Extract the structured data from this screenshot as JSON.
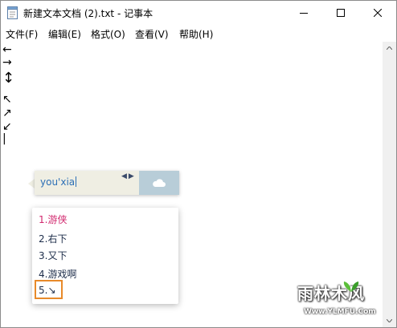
{
  "window": {
    "title": "新建文本文档 (2).txt - 记事本"
  },
  "menu": [
    {
      "label": "文件(F)"
    },
    {
      "label": "编辑(E)"
    },
    {
      "label": "格式(O)"
    },
    {
      "label": "查看(V)"
    },
    {
      "label": "帮助(H)"
    }
  ],
  "editor": {
    "lines": [
      "←",
      "→",
      "↕",
      "↖",
      "↗",
      "↙",
      "|"
    ]
  },
  "ime": {
    "composition": "you'xia",
    "nav": "◀▶",
    "icon": "cloud-icon"
  },
  "candidates": [
    {
      "text": "1.游侠"
    },
    {
      "text": "2.右下"
    },
    {
      "text": "3.又下"
    },
    {
      "text": "4.游戏啊"
    },
    {
      "text": "5.↘"
    }
  ],
  "watermark": {
    "main": "雨林木风",
    "sub": "Www.YLMFU.Com"
  }
}
